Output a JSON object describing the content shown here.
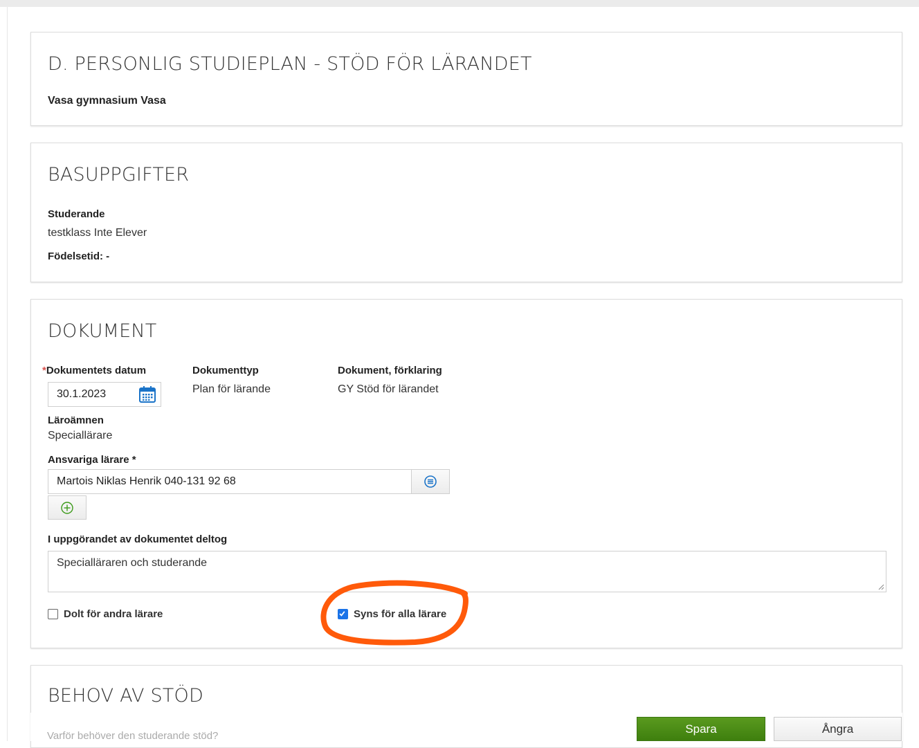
{
  "header_panel": {
    "title": "D. PERSONLIG STUDIEPLAN - STÖD FÖR LÄRANDET",
    "school": "Vasa gymnasium Vasa"
  },
  "basic_panel": {
    "title": "BASUPPGIFTER",
    "student_label": "Studerande",
    "student_value": "testklass Inte Elever",
    "birth_label": "Födelsetid: -"
  },
  "document_panel": {
    "title": "DOKUMENT",
    "date_required_mark": "*",
    "date_label": "Dokumentets datum",
    "date_value": "30.1.2023",
    "type_label": "Dokumenttyp",
    "type_value": "Plan för lärande",
    "explanation_label": "Dokument, förklaring",
    "explanation_value": "GY Stöd för lärandet",
    "subjects_label": "Läroämnen",
    "subjects_value": "Speciallärare",
    "teachers_label": "Ansvariga lärare *",
    "teachers_value": "Martois Niklas Henrik 040-131 92 68",
    "participants_label": "I uppgörandet av dokumentet deltog",
    "participants_value": "Specialläraren och studerande",
    "hidden_label": "Dolt för andra lärare",
    "hidden_checked": false,
    "visible_label": "Syns för alla lärare",
    "visible_checked": true
  },
  "support_panel": {
    "title": "BEHOV AV STÖD",
    "question": "Varför behöver den studerande stöd?"
  },
  "actions": {
    "save_label": "Spara",
    "undo_label": "Ångra"
  },
  "colors": {
    "save_button": "#4a8c16",
    "checkbox_checked": "#1a73e8",
    "annotation": "#ff5a0a",
    "required_mark": "#d9534f",
    "calendar_icon": "#1a73c8"
  },
  "icons": {
    "calendar": "calendar-icon",
    "list": "list-icon",
    "add": "plus-circle-icon"
  }
}
